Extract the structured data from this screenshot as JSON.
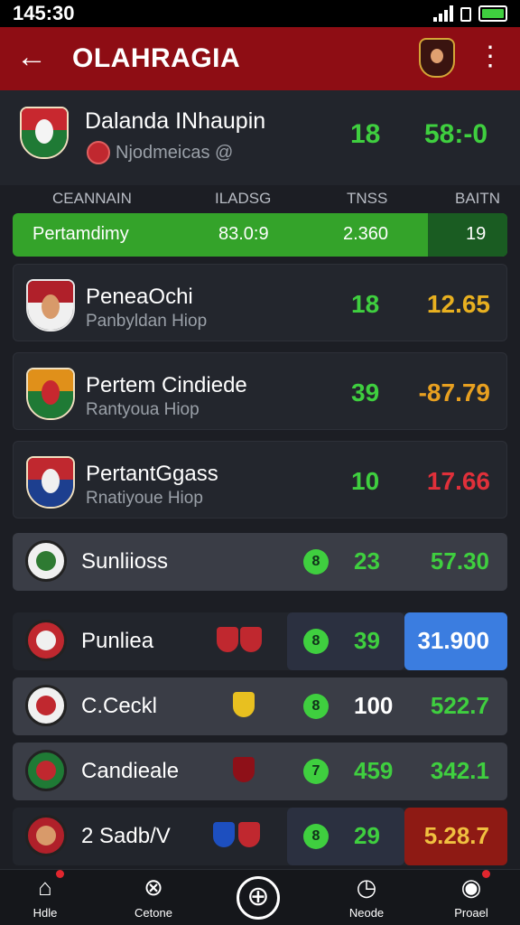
{
  "status_bar": {
    "time": "145:30"
  },
  "app_bar": {
    "title": "OLAHRAGIA"
  },
  "match": {
    "name": "Dalanda INhaupin",
    "sub": "Njodmeicas @",
    "n1": "18",
    "n2": "58:-0"
  },
  "columns": [
    "CEANNAIN",
    "ILADSG",
    "TNSS",
    "BAITN"
  ],
  "highlight": {
    "name": "Pertamdimy",
    "v1": "83.0:9",
    "v2": "2.360",
    "v3": "19"
  },
  "cards": [
    {
      "title": "PeneaOchi",
      "sub": "Panbyldan Hiop",
      "v1": "18",
      "v2": "12.65",
      "color": "#e8b020"
    },
    {
      "title": "Pertem Cindiede",
      "sub": "Rantyoua Hiop",
      "v1": "39",
      "v2": "-87.79",
      "color": "#e8a020"
    },
    {
      "title": "PertantGgass",
      "sub": "Rnatiyoue Hiop",
      "v1": "10",
      "v2": "17.66",
      "color": "#e0303a"
    }
  ],
  "rows": [
    {
      "label": "Sunliioss",
      "dot": "8",
      "c1": "23",
      "c2": "57.30"
    },
    {
      "label": "Punliea",
      "dot": "8",
      "c1": "39",
      "c2": "31.900"
    },
    {
      "label": "C.Ceckl",
      "dot": "8",
      "c1": "100",
      "c2": "522.7"
    },
    {
      "label": "Candieale",
      "dot": "7",
      "c1": "459",
      "c2": "342.1"
    },
    {
      "label": "2 Sadb/V",
      "dot": "8",
      "c1": "29",
      "c2": "5.28.7"
    }
  ],
  "bottom_nav": [
    {
      "label": "Hdle",
      "icon": "home-icon"
    },
    {
      "label": "Cetone",
      "icon": "crossed-ball-icon"
    },
    {
      "label": "",
      "icon": "add-circle-icon"
    },
    {
      "label": "Neode",
      "icon": "clock-icon"
    },
    {
      "label": "Proael",
      "icon": "profile-icon"
    }
  ]
}
